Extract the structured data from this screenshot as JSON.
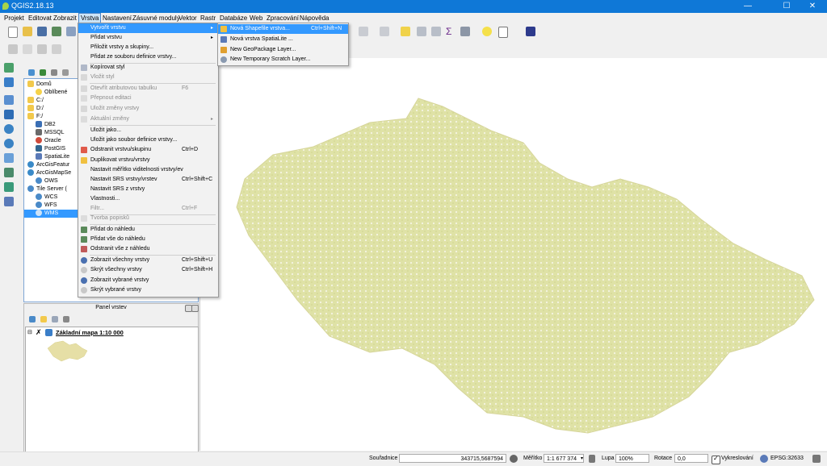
{
  "window": {
    "title": "QGIS2.18.13",
    "min": "—",
    "max": "☐",
    "close": "✕"
  },
  "menubar": [
    {
      "label": "Projekt"
    },
    {
      "label": "Editovat"
    },
    {
      "label": "Zobrazit"
    },
    {
      "label": "Vrstva"
    },
    {
      "label": "Nastavení"
    },
    {
      "label": "Zásuvné moduly"
    },
    {
      "label": "Vektor"
    },
    {
      "label": "Rastr"
    },
    {
      "label": "Databáze"
    },
    {
      "label": "Web"
    },
    {
      "label": "Zpracování"
    },
    {
      "label": "Nápověda"
    }
  ],
  "layer_menu": {
    "items": [
      {
        "label": "Vytvořit vrstvu",
        "shortcut": "",
        "submenu": true,
        "highlighted": true
      },
      {
        "label": "Přidat vrstvu",
        "shortcut": "",
        "submenu": true
      },
      {
        "label": "Přiložit vrstvy a skupiny...",
        "shortcut": ""
      },
      {
        "label": "Přidat ze souboru definice vrstvy...",
        "shortcut": ""
      },
      {
        "label": "Kopírovat styl",
        "shortcut": ""
      },
      {
        "label": "Vložit styl",
        "shortcut": "",
        "disabled": true
      },
      {
        "label": "Otevřít atributovou tabulku",
        "shortcut": "F6",
        "disabled": true
      },
      {
        "label": "Přepnout editaci",
        "shortcut": "",
        "disabled": true
      },
      {
        "label": "Uložit změny vrstvy",
        "shortcut": "",
        "disabled": true
      },
      {
        "label": "Aktuální změny",
        "shortcut": "",
        "disabled": true,
        "submenu": true
      },
      {
        "label": "Uložit jako...",
        "shortcut": ""
      },
      {
        "label": "Uložit jako soubor definice vrstvy...",
        "shortcut": ""
      },
      {
        "label": "Odstranit vrstvu/skupinu",
        "shortcut": "Ctrl+D"
      },
      {
        "label": "Duplikovat vrstvu/vrstvy",
        "shortcut": ""
      },
      {
        "label": "Nastavit měřítko viditelnosti vrstvy/ev",
        "shortcut": ""
      },
      {
        "label": "Nastavit SRS vrstvy/vrstev",
        "shortcut": "Ctrl+Shift+C"
      },
      {
        "label": "Nastavit SRS z vrstvy",
        "shortcut": ""
      },
      {
        "label": "Vlastnosti...",
        "shortcut": ""
      },
      {
        "label": "Filtr...",
        "shortcut": "Ctrl+F",
        "disabled": true
      },
      {
        "label": "Tvorba popisků",
        "shortcut": "",
        "disabled": true
      },
      {
        "label": "Přidat do náhledu",
        "shortcut": ""
      },
      {
        "label": "Přidat vše do náhledu",
        "shortcut": ""
      },
      {
        "label": "Odstranit vše z náhledu",
        "shortcut": ""
      },
      {
        "label": "Zobrazit všechny vrstvy",
        "shortcut": "Ctrl+Shift+U"
      },
      {
        "label": "Skrýt všechny vrstvy",
        "shortcut": "Ctrl+Shift+H"
      },
      {
        "label": "Zobrazit vybrané vrstvy",
        "shortcut": ""
      },
      {
        "label": "Skrýt vybrané vrstvy",
        "shortcut": ""
      }
    ]
  },
  "create_submenu": {
    "items": [
      {
        "label": "Nová Shapefile vrstva...",
        "shortcut": "Ctrl+Shift+N",
        "highlighted": true
      },
      {
        "label": "Nová vrstva SpatiaLite ...",
        "shortcut": ""
      },
      {
        "label": "New GeoPackage Layer...",
        "shortcut": ""
      },
      {
        "label": "New Temporary Scratch Layer...",
        "shortcut": ""
      }
    ]
  },
  "browser": {
    "items": [
      {
        "label": "Domů",
        "icon": "folder-icon"
      },
      {
        "label": "Oblíbené",
        "icon": "star-icon"
      },
      {
        "label": "C:/",
        "icon": "folder-icon"
      },
      {
        "label": "D:/",
        "icon": "folder-icon"
      },
      {
        "label": "F:/",
        "icon": "folder-icon"
      },
      {
        "label": "DB2",
        "icon": "db2-icon"
      },
      {
        "label": "MSSQL",
        "icon": "mssql-icon"
      },
      {
        "label": "Oracle",
        "icon": "oracle-icon"
      },
      {
        "label": "PostGIS",
        "icon": "postgis-icon"
      },
      {
        "label": "SpatiaLite",
        "icon": "spatialite-icon"
      },
      {
        "label": "ArcGisFeatur",
        "icon": "arcgis-icon"
      },
      {
        "label": "ArcGisMapSe",
        "icon": "arcgis-icon"
      },
      {
        "label": "OWS",
        "icon": "globe-icon"
      },
      {
        "label": "Tile Server (",
        "icon": "globe-icon"
      },
      {
        "label": "WCS",
        "icon": "globe-icon"
      },
      {
        "label": "WFS",
        "icon": "globe-icon"
      },
      {
        "label": "WMS",
        "icon": "globe-icon",
        "selected": true
      }
    ]
  },
  "layers_panel": {
    "title": "Panel vrstev",
    "layer_name": "Základní mapa 1:10 000"
  },
  "statusbar": {
    "coord_label": "Souřadnice",
    "coord_value": "343715,5687594",
    "scale_label": "Měřítko",
    "scale_value": "1:1 677 374",
    "zoom_label": "Lupa",
    "zoom_value": "100%",
    "rotation_label": "Rotace",
    "rotation_value": "0,0",
    "render_label": "Vykreslování",
    "crs": "EPSG:32633"
  },
  "colors": {
    "title_bar": "#0f78d7",
    "highlight": "#3399ff",
    "map_fill": "#dfe2a6"
  }
}
